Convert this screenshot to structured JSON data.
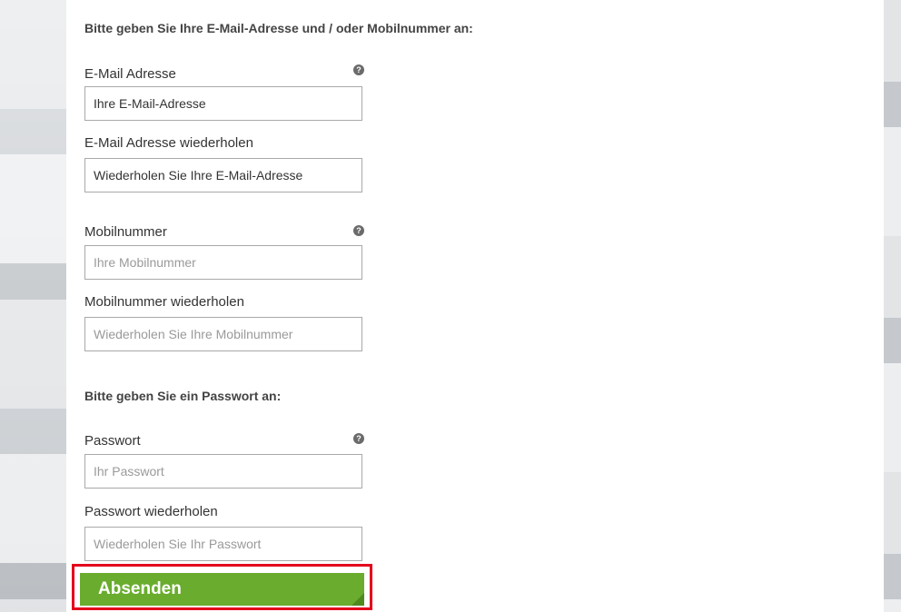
{
  "form": {
    "contact_heading": "Bitte geben Sie Ihre E-Mail-Adresse und / oder Mobilnummer an:",
    "email_label": "E-Mail Adresse",
    "email_placeholder": "Ihre E-Mail-Adresse",
    "email_repeat_label": "E-Mail Adresse wiederholen",
    "email_repeat_placeholder": "Wiederholen Sie Ihre E-Mail-Adresse",
    "mobile_label": "Mobilnummer",
    "mobile_placeholder": "Ihre Mobilnummer",
    "mobile_repeat_label": "Mobilnummer wiederholen",
    "mobile_repeat_placeholder": "Wiederholen Sie Ihre Mobilnummer",
    "password_heading": "Bitte geben Sie ein Passwort an:",
    "password_label": "Passwort",
    "password_placeholder": "Ihr Passwort",
    "password_repeat_label": "Passwort wiederholen",
    "password_repeat_placeholder": "Wiederholen Sie Ihr Passwort",
    "help_glyph": "?",
    "submit_label": "Absenden"
  },
  "colors": {
    "submit_bg": "#6aac2e",
    "highlight_border": "#e3001b"
  },
  "icons": {
    "help": "help-icon"
  }
}
